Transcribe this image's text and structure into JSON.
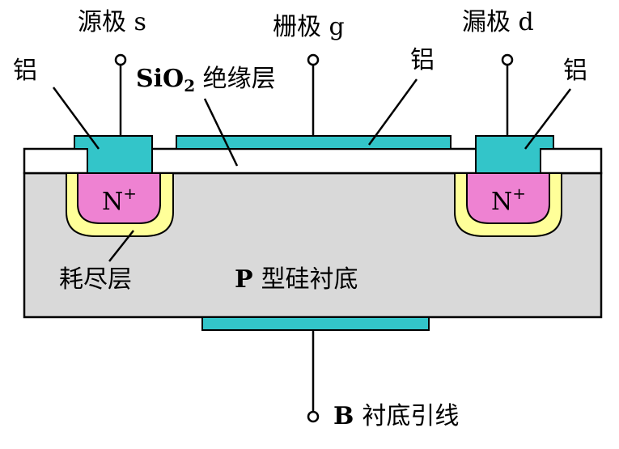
{
  "labels": {
    "source": "源极 s",
    "gate": "栅极 g",
    "drain": "漏极 d",
    "al_left": "铝",
    "al_gate": "铝",
    "al_right": "铝",
    "sio2_formula": "SiO",
    "sio2_sub": "2",
    "sio2_suffix": " 绝缘层",
    "n_region": "N",
    "n_sup": "+",
    "depletion": "耗尽层",
    "substrate_p": "P",
    "substrate_text": "型硅衬底",
    "bulk_b": "B",
    "bulk_text": "衬底引线"
  },
  "colors": {
    "substrate": "#d9d9d9",
    "oxide": "#ffffff",
    "metal": "#33c5c9",
    "n_plus": "#ee82d2",
    "depletion": "#ffff99",
    "outline": "#000000"
  }
}
